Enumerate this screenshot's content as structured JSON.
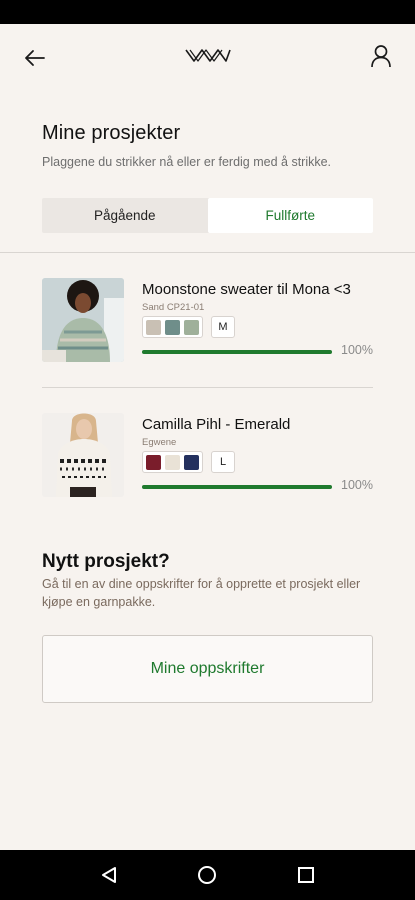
{
  "header": {
    "back_icon": "arrow-left-icon",
    "logo_icon": "brand-logo-icon",
    "profile_icon": "user-icon"
  },
  "page": {
    "title": "Mine prosjekter",
    "subtitle": "Plaggene du strikker nå eller er ferdig med å strikke."
  },
  "tabs": [
    {
      "label": "Pågående",
      "active": false
    },
    {
      "label": "Fullførte",
      "active": true
    }
  ],
  "projects": [
    {
      "name": "Moonstone sweater til Mona <3",
      "yarn": "Sand CP21-01",
      "colors": [
        "#c9c0b4",
        "#6f8e8a",
        "#9fb09a"
      ],
      "size": "M",
      "progress": 100,
      "progress_text": "100%"
    },
    {
      "name": "Camilla Pihl - Emerald",
      "yarn": "Egwene",
      "colors": [
        "#7a1d2b",
        "#e9e2d6",
        "#23305e"
      ],
      "size": "L",
      "progress": 100,
      "progress_text": "100%"
    }
  ],
  "new_project": {
    "title": "Nytt prosjekt?",
    "description": "Gå til en av dine oppskrifter for å opprette et prosjekt eller kjøpe en garnpakke.",
    "button_label": "Mine oppskrifter"
  },
  "colors": {
    "accent": "#1f7a2e",
    "background": "#f7f3ef"
  },
  "system_nav": {
    "back_icon": "triangle-back-icon",
    "home_icon": "circle-home-icon",
    "recents_icon": "square-recents-icon"
  }
}
